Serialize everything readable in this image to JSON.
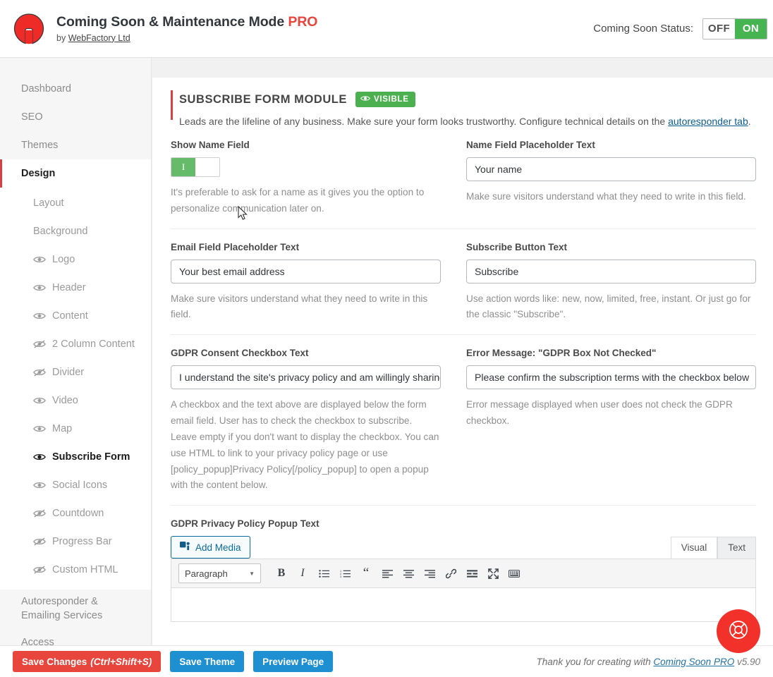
{
  "header": {
    "logo_icon": "wrench-logo-icon",
    "title_main": "Coming Soon & Maintenance Mode",
    "title_pro": "PRO",
    "by_label": "by",
    "author": "WebFactory Ltd",
    "status_label": "Coming Soon Status:",
    "status_off": "OFF",
    "status_on": "ON",
    "status_value": "ON"
  },
  "sidebar": {
    "items": [
      {
        "label": "Dashboard",
        "active": false
      },
      {
        "label": "SEO",
        "active": false
      },
      {
        "label": "Themes",
        "active": false
      },
      {
        "label": "Design",
        "active": true
      }
    ],
    "sub_items": [
      {
        "label": "Layout",
        "icon": "none",
        "active": false
      },
      {
        "label": "Background",
        "icon": "none",
        "active": false
      },
      {
        "label": "Logo",
        "icon": "eye-icon",
        "active": false
      },
      {
        "label": "Header",
        "icon": "eye-icon",
        "active": false
      },
      {
        "label": "Content",
        "icon": "eye-icon",
        "active": false
      },
      {
        "label": "2 Column Content",
        "icon": "eye-slash-icon",
        "active": false
      },
      {
        "label": "Divider",
        "icon": "eye-slash-icon",
        "active": false
      },
      {
        "label": "Video",
        "icon": "eye-icon",
        "active": false
      },
      {
        "label": "Map",
        "icon": "eye-icon",
        "active": false
      },
      {
        "label": "Subscribe Form",
        "icon": "eye-icon",
        "active": true
      },
      {
        "label": "Social Icons",
        "icon": "eye-icon",
        "active": false
      },
      {
        "label": "Countdown",
        "icon": "eye-slash-icon",
        "active": false
      },
      {
        "label": "Progress Bar",
        "icon": "eye-slash-icon",
        "active": false
      },
      {
        "label": "Custom HTML",
        "icon": "eye-slash-icon",
        "active": false
      }
    ],
    "bottom_items": [
      {
        "label": "Autoresponder & Emailing Services"
      },
      {
        "label": "Access"
      }
    ]
  },
  "module": {
    "title": "SUBSCRIBE FORM MODULE",
    "badge": "VISIBLE",
    "desc_before": "Leads are the lifeline of any business. Make sure your form looks trustworthy. Configure technical details on the ",
    "desc_link": "autoresponder tab",
    "desc_after": "."
  },
  "fields": {
    "show_name": {
      "label": "Show Name Field",
      "toggle_on_glyph": "I",
      "toggle_state": "on",
      "help": "It's preferable to ask for a name as it gives you the option to personalize communication later on."
    },
    "name_placeholder": {
      "label": "Name Field Placeholder Text",
      "value": "Your name",
      "help": "Make sure visitors understand what they need to write in this field."
    },
    "email_placeholder": {
      "label": "Email Field Placeholder Text",
      "value": "Your best email address",
      "help": "Make sure visitors understand what they need to write in this field."
    },
    "subscribe_button": {
      "label": "Subscribe Button Text",
      "value": "Subscribe",
      "help": "Use action words like: new, now, limited, free, instant. Or just go for the classic \"Subscribe\"."
    },
    "gdpr_consent": {
      "label": "GDPR Consent Checkbox Text",
      "value": "I understand the site's privacy policy and am willingly sharing",
      "help": "A checkbox and the text above are displayed below the form email field. User has to check the checkbox to subscribe. Leave empty if you don't want to display the checkbox. You can use HTML to link to your privacy policy page or use [policy_popup]Privacy Policy[/policy_popup] to open a popup with the content below."
    },
    "gdpr_error": {
      "label": "Error Message: \"GDPR Box Not Checked\"",
      "value": "Please confirm the subscription terms with the checkbox below",
      "help": "Error message displayed when user does not check the GDPR checkbox."
    },
    "gdpr_popup": {
      "label": "GDPR Privacy Policy Popup Text"
    }
  },
  "editor": {
    "add_media": "Add Media",
    "add_media_icon": "media-icon",
    "tabs": [
      {
        "label": "Visual",
        "active": true
      },
      {
        "label": "Text",
        "active": false
      }
    ],
    "format_select": "Paragraph",
    "caret_icon": "chevron-down-icon",
    "buttons": [
      {
        "name": "bold-button",
        "glyph": "B"
      },
      {
        "name": "italic-button",
        "glyph": "I"
      },
      {
        "name": "bulleted-list-button",
        "glyph": "list"
      },
      {
        "name": "numbered-list-button",
        "glyph": "numlist"
      },
      {
        "name": "blockquote-button",
        "glyph": "“"
      },
      {
        "name": "align-left-button",
        "glyph": "alignleft"
      },
      {
        "name": "align-center-button",
        "glyph": "aligncenter"
      },
      {
        "name": "align-right-button",
        "glyph": "alignright"
      },
      {
        "name": "insert-link-button",
        "glyph": "link"
      },
      {
        "name": "read-more-button",
        "glyph": "more"
      },
      {
        "name": "fullscreen-button",
        "glyph": "fullscreen"
      },
      {
        "name": "keyboard-shortcuts-button",
        "glyph": "keyboard"
      }
    ]
  },
  "footer": {
    "save_changes": "Save Changes",
    "save_changes_shortcut": "(Ctrl+Shift+S)",
    "save_theme": "Save Theme",
    "preview_page": "Preview Page",
    "thanks_before": "Thank you for creating with ",
    "thanks_link": "Coming Soon PRO",
    "version": "v5.90",
    "support_icon": "lifebuoy-icon"
  },
  "colors": {
    "brand_red": "#e8453c",
    "accent_red": "#d64040",
    "green": "#46b450",
    "blue": "#1e90d2"
  }
}
